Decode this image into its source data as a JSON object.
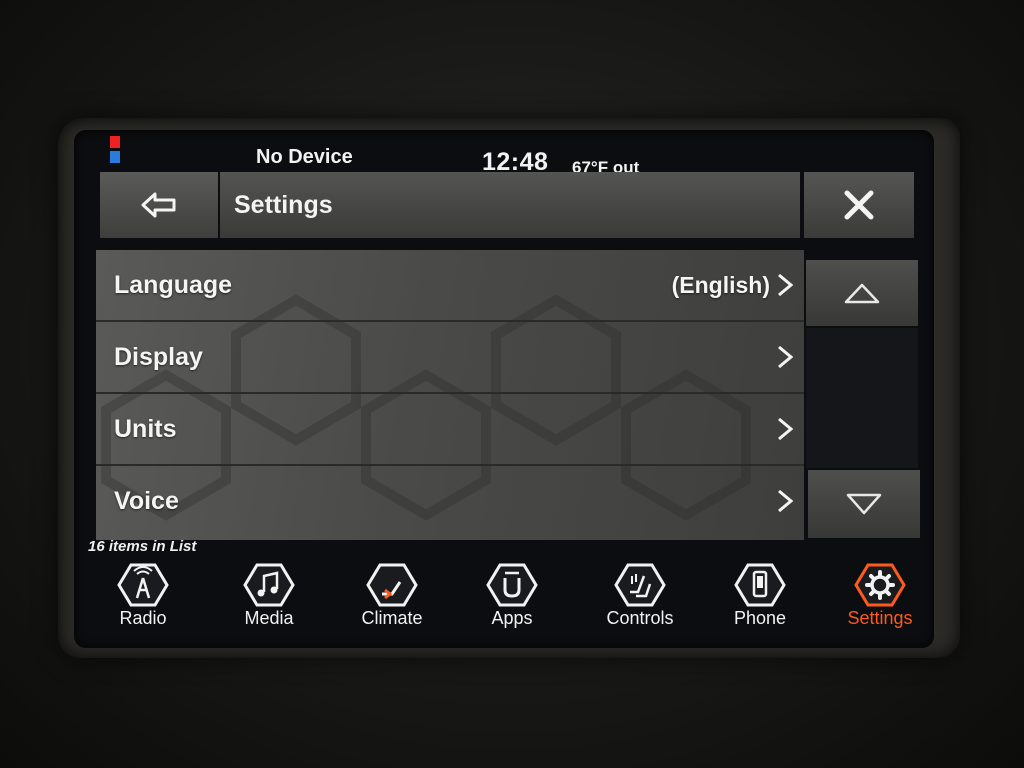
{
  "status": {
    "device": "No Device",
    "clock": "12:48",
    "temperature": "67°F out"
  },
  "header": {
    "back_icon": "back-arrow-icon",
    "title": "Settings",
    "close_icon": "close-icon"
  },
  "settings_list": {
    "rows": [
      {
        "label": "Language",
        "value": "(English)"
      },
      {
        "label": "Display",
        "value": ""
      },
      {
        "label": "Units",
        "value": ""
      },
      {
        "label": "Voice",
        "value": ""
      }
    ],
    "count_text": "16 items in List"
  },
  "scroll": {
    "up_icon": "triangle-up-icon",
    "down_icon": "triangle-down-icon"
  },
  "nav": {
    "items": [
      {
        "label": "Radio",
        "icon": "radio-tower-icon"
      },
      {
        "label": "Media",
        "icon": "music-note-icon"
      },
      {
        "label": "Climate",
        "icon": "climate-seat-icon"
      },
      {
        "label": "Apps",
        "icon": "apps-u-icon"
      },
      {
        "label": "Controls",
        "icon": "controls-seat-icon"
      },
      {
        "label": "Phone",
        "icon": "phone-icon"
      },
      {
        "label": "Settings",
        "icon": "gear-icon"
      }
    ],
    "active": "Settings"
  },
  "colors": {
    "accent": "#ff5a1e",
    "text": "#f2f2f2",
    "panel": "#4a4a48"
  }
}
